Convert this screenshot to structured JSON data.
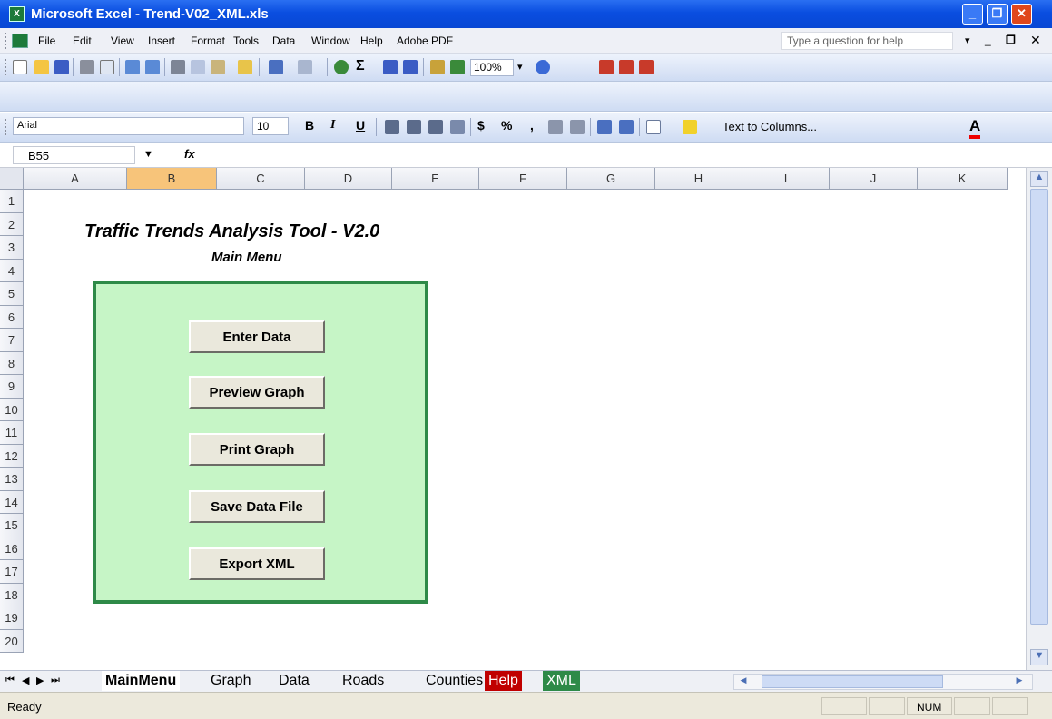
{
  "window": {
    "title": "Microsoft Excel - Trend-V02_XML.xls",
    "app_icon": "X"
  },
  "menubar": {
    "items": [
      "File",
      "Edit",
      "View",
      "Insert",
      "Format",
      "Tools",
      "Data",
      "Window",
      "Help",
      "Adobe PDF"
    ],
    "help_placeholder": "Type a question for help"
  },
  "toolbar": {
    "zoom": "100%"
  },
  "format_toolbar": {
    "font": "Arial",
    "size": "10",
    "bold": "B",
    "italic": "I",
    "underline": "U",
    "currency": "$",
    "percent": "%",
    "comma": ",",
    "text_to_columns": "Text to Columns...",
    "font_color": "A"
  },
  "formula_bar": {
    "cell_ref": "B55",
    "fx": "fx",
    "value": ""
  },
  "grid": {
    "columns": [
      "A",
      "B",
      "C",
      "D",
      "E",
      "F",
      "G",
      "H",
      "I",
      "J",
      "K"
    ],
    "selected_column": "B",
    "rows": [
      "1",
      "2",
      "3",
      "4",
      "5",
      "6",
      "7",
      "8",
      "9",
      "10",
      "11",
      "12",
      "13",
      "14",
      "15",
      "16",
      "17",
      "18",
      "19",
      "20"
    ]
  },
  "sheet": {
    "heading": "Traffic Trends Analysis Tool - V2.0",
    "subheading": "Main Menu",
    "buttons": [
      "Enter Data",
      "Preview Graph",
      "Print Graph",
      "Save Data File",
      "Export XML"
    ]
  },
  "tabs": [
    {
      "label": "MainMenu",
      "active": true,
      "color": ""
    },
    {
      "label": "Graph",
      "active": false,
      "color": ""
    },
    {
      "label": "Data",
      "active": false,
      "color": ""
    },
    {
      "label": "Roads",
      "active": false,
      "color": ""
    },
    {
      "label": "Counties",
      "active": false,
      "color": ""
    },
    {
      "label": "Help",
      "active": false,
      "color": "#c00000"
    },
    {
      "label": "XML",
      "active": false,
      "color": "#2e8a48"
    }
  ],
  "status": {
    "text": "Ready",
    "num": "NUM"
  },
  "colors": {
    "titlebar": "#0a4ee0",
    "menu_panel": "#c6f5c6",
    "menu_border": "#2e8a48",
    "selected_header": "#f7c47a"
  }
}
